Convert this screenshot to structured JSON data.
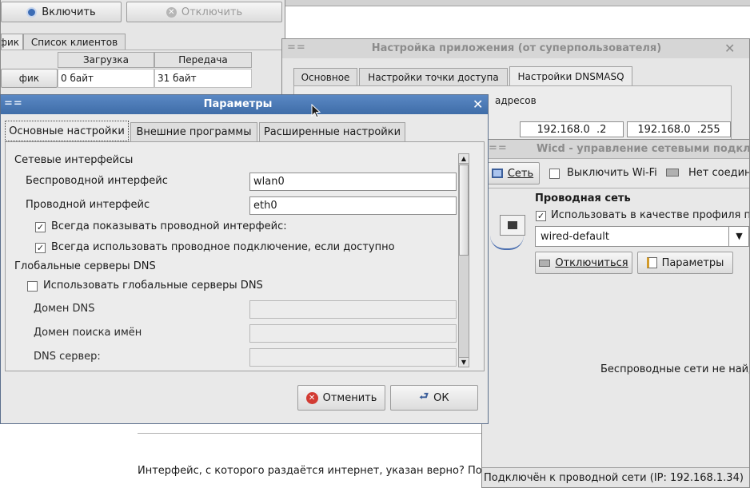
{
  "top_window": {
    "enable_button": "Включить",
    "disable_button": "Отключить",
    "tabs": [
      "фик",
      "Список клиентов"
    ],
    "col_download": "Загрузка",
    "col_upload": "Передача",
    "row_label": "фик",
    "row_download": "0 байт",
    "row_upload": "31 байт"
  },
  "app_settings": {
    "title": "Настройка приложения (от суперпользователя)",
    "tabs": [
      "Основное",
      "Настройки точки доступа",
      "Настройки DNSMASQ"
    ],
    "addresses_label": "адресов",
    "ip_start": "192.168.0  .2",
    "ip_end": "192.168.0  .255"
  },
  "wicd": {
    "title": "Wicd - управление сетевыми подкл",
    "network_button": "Сеть",
    "disable_wifi_label": "Выключить Wi-Fi",
    "no_connection_label": "Нет соедин",
    "wired_heading": "Проводная сеть",
    "use_profile_label": "Использовать в качестве профиля п",
    "profile_value": "wired-default",
    "disconnect_button": "Отключиться",
    "settings_button": "Параметры",
    "wireless_message": "Беспроводные сети не найд",
    "status": "Подключён к проводной сети (IP: 192.168.1.34)"
  },
  "background_text": "Интерфейс, с которого раздаётся интернет, указан верно? По-умо",
  "dialog": {
    "title": "Параметры",
    "tabs": [
      "Основные настройки",
      "Внешние программы",
      "Расширенные настройки"
    ],
    "section_interfaces": "Сетевые интерфейсы",
    "wireless_label": "Беспроводной интерфейс",
    "wireless_value": "wlan0",
    "wired_label": "Проводной интерфейс",
    "wired_value": "eth0",
    "always_show_wired": "Всегда показывать проводной интерфейс:",
    "always_use_wired": "Всегда использовать проводное подключение, если доступно",
    "section_dns": "Глобальные серверы DNS",
    "use_global_dns": "Использовать глобальные серверы DNS",
    "dns_domain_label": "Домен DNS",
    "search_domain_label": "Домен поиска имён",
    "dns_server_label": "DNS сервер:",
    "cancel_button": "Отменить",
    "ok_button": "ОК"
  },
  "colors": {
    "dialog_titlebar": "#4a7ab7",
    "inactive_titlebar": "#d4d4d4",
    "window_bg": "#e6e6e6"
  }
}
